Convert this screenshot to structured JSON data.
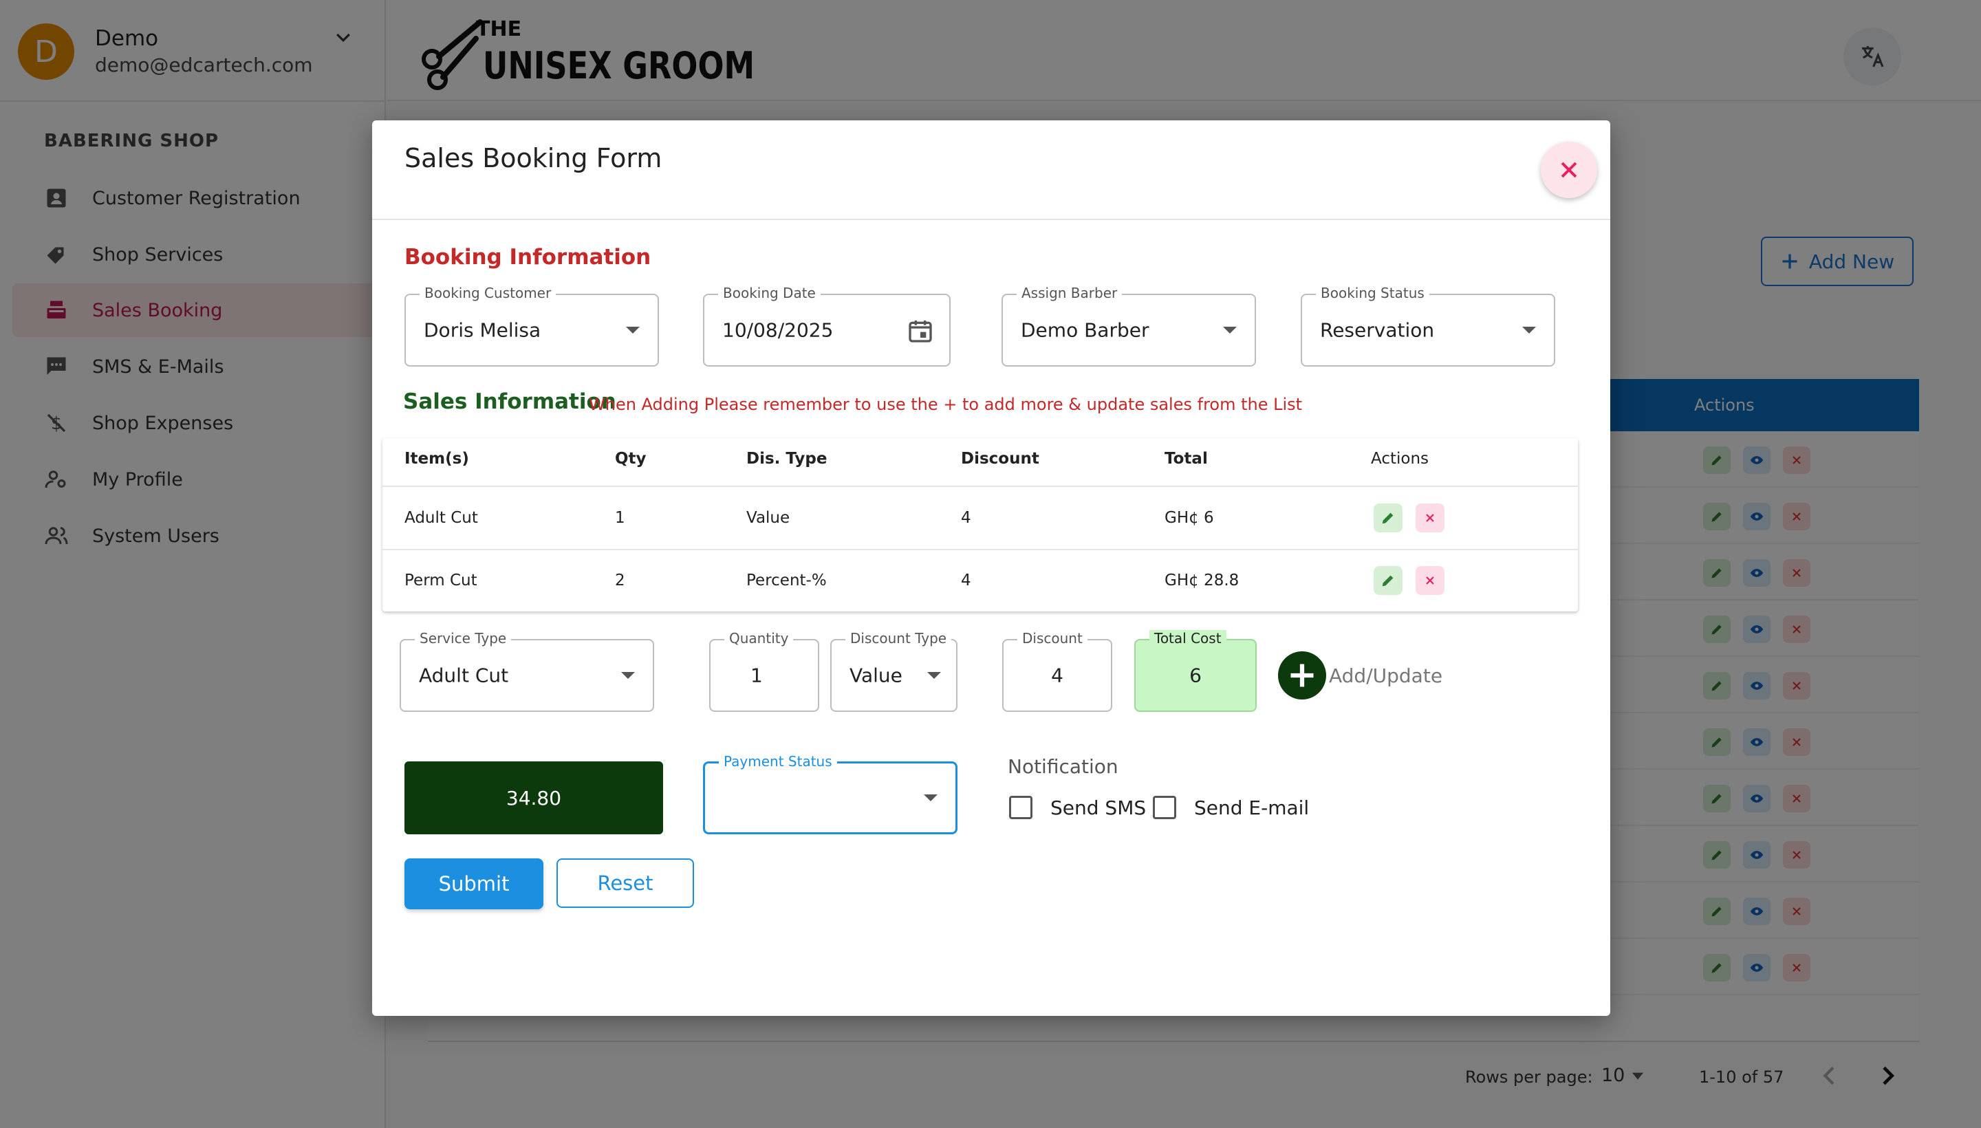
{
  "user": {
    "initial": "D",
    "name": "Demo",
    "email": "demo@edcartech.com"
  },
  "sidebar": {
    "heading": "BABERING SHOP",
    "items": [
      {
        "label": "Customer Registration",
        "icon": "contact-card-icon",
        "active": false
      },
      {
        "label": "Shop Services",
        "icon": "tag-icon",
        "active": false
      },
      {
        "label": "Sales Booking",
        "icon": "cash-register-icon",
        "active": true
      },
      {
        "label": "SMS & E-Mails",
        "icon": "message-icon",
        "active": false
      },
      {
        "label": "Shop Expenses",
        "icon": "money-off-icon",
        "active": false
      },
      {
        "label": "My Profile",
        "icon": "person-settings-icon",
        "active": false
      },
      {
        "label": "System Users",
        "icon": "group-icon",
        "active": false
      }
    ]
  },
  "brand": {
    "logo_small": "THE",
    "logo_main": "UNISEX GROOM"
  },
  "page": {
    "add_new_label": "Add New",
    "list_actions_header": "Actions",
    "pagination": {
      "rows_per_page_label": "Rows per page:",
      "rows_per_page": "10",
      "range": "1-10 of 57"
    }
  },
  "modal": {
    "title": "Sales Booking Form",
    "booking_info_heading": "Booking Information",
    "booking_customer": {
      "label": "Booking Customer",
      "value": "Doris Melisa"
    },
    "booking_date": {
      "label": "Booking Date",
      "value": "10/08/2025"
    },
    "assign_barber": {
      "label": "Assign Barber",
      "value": "Demo Barber"
    },
    "booking_status": {
      "label": "Booking Status",
      "value": "Reservation"
    },
    "sales_info_heading": "Sales Information",
    "sales_info_note": "When Adding Please remember to use the + to add more & update sales from the List",
    "table": {
      "headers": {
        "item": "Item(s)",
        "qty": "Qty",
        "dis_type": "Dis. Type",
        "discount": "Discount",
        "total": "Total",
        "actions": "Actions"
      },
      "rows": [
        {
          "item": "Adult Cut",
          "qty": "1",
          "dis_type": "Value",
          "discount": "4",
          "total": "GH¢ 6"
        },
        {
          "item": "Perm Cut",
          "qty": "2",
          "dis_type": "Percent-%",
          "discount": "4",
          "total": "GH¢ 28.8"
        }
      ]
    },
    "service_type": {
      "label": "Service Type",
      "value": "Adult Cut"
    },
    "quantity": {
      "label": "Quantity",
      "value": "1"
    },
    "discount_type": {
      "label": "Discount Type",
      "value": "Value"
    },
    "discount": {
      "label": "Discount",
      "value": "4"
    },
    "total_cost": {
      "label": "Total Cost",
      "value": "6"
    },
    "add_update_label": "Add/Update",
    "grand_total": "34.80",
    "payment_status": {
      "label": "Payment Status",
      "value": ""
    },
    "notification": {
      "label": "Notification",
      "send_sms": "Send SMS",
      "send_email": "Send E-mail"
    },
    "submit_label": "Submit",
    "reset_label": "Reset"
  },
  "colors": {
    "primary": "#1c8fe0",
    "brand_dark_green": "#0c3a0c",
    "heading_red": "#c62828",
    "heading_green": "#1b5e20",
    "active_nav": "#c2185b",
    "total_cost_bg": "#c8f7c5",
    "list_header_blue": "#0d6fc2"
  }
}
